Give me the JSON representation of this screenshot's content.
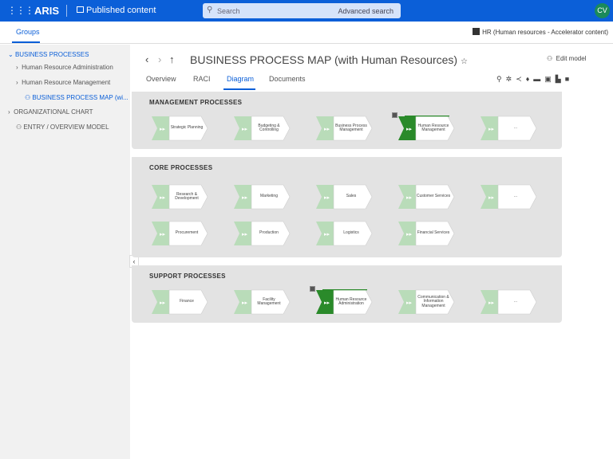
{
  "header": {
    "app_name": "ARIS",
    "section": "Published content",
    "search_placeholder": "Search",
    "advanced_search": "Advanced search",
    "avatar_initials": "CV",
    "brand_color": "#0b5fd8"
  },
  "subbar": {
    "tab": "Groups",
    "database": "HR (Human resources - Accelerator content)"
  },
  "sidebar": {
    "items": [
      {
        "label": "BUSINESS PROCESSES",
        "icon": "chevron-down-icon"
      },
      {
        "label": "Human Resource Administration",
        "icon": "chevron-right-icon"
      },
      {
        "label": "Human Resource Management",
        "icon": "chevron-right-icon"
      },
      {
        "label": "BUSINESS PROCESS MAP (wi...",
        "icon": "model-icon"
      },
      {
        "label": "ORGANIZATIONAL CHART",
        "icon": "chevron-right-icon"
      },
      {
        "label": "ENTRY / OVERVIEW MODEL",
        "icon": "model-icon"
      }
    ]
  },
  "main": {
    "title": "BUSINESS PROCESS MAP (with Human Resources)",
    "edit_model": "Edit model",
    "tabs": [
      "Overview",
      "RACI",
      "Diagram",
      "Documents"
    ],
    "active_tab": "Diagram",
    "toolbar_icons": [
      "search-icon",
      "highlight-icon",
      "share-icon",
      "pin-icon",
      "print-icon",
      "copy-icon",
      "chart-icon",
      "info-icon"
    ]
  },
  "diagram": {
    "lanes": [
      {
        "title": "MANAGEMENT PROCESSES",
        "rows": [
          [
            "Strategic Planning",
            "Budgeting & Controlling",
            "Business Process Management",
            "Human Resource Management",
            "..."
          ]
        ],
        "highlighted": [
          "Human Resource Management"
        ]
      },
      {
        "title": "CORE PROCESSES",
        "rows": [
          [
            "Research & Development",
            "Marketing",
            "Sales",
            "Customer Services",
            "..."
          ],
          [
            "Procurement",
            "Production",
            "Logistics",
            "Financial Services"
          ]
        ],
        "highlighted": []
      },
      {
        "title": "SUPPORT PROCESSES",
        "rows": [
          [
            "Finance",
            "Facility Management",
            "Human Resource Administration",
            "Communication & Information Management",
            "..."
          ]
        ],
        "highlighted": [
          "Human Resource Administration"
        ]
      }
    ],
    "colors": {
      "light_green": "#b9dcb9",
      "dark_green": "#2a8a2a",
      "lane_bg": "#e3e3e3"
    }
  }
}
